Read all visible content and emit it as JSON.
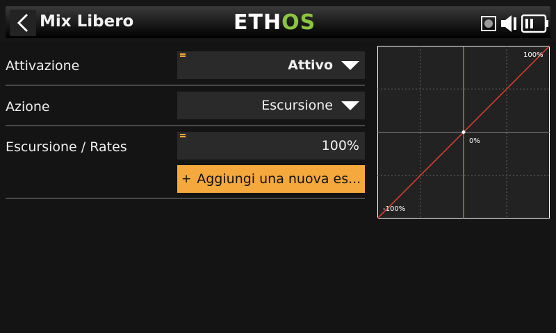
{
  "header": {
    "title": "Mix Libero",
    "logo_part1": "ETH",
    "logo_part2": "OS",
    "back_icon": "chevron-left-icon",
    "status_icons": [
      "record-icon",
      "speaker-icon",
      "battery-icon"
    ]
  },
  "rows": {
    "activation": {
      "label": "Attivazione",
      "value": "Attivo"
    },
    "action": {
      "label": "Azione",
      "value": "Escursione"
    },
    "rates": {
      "label": "Escursione / Rates",
      "value": "100%"
    }
  },
  "add_button": {
    "icon": "+",
    "label": "Aggiungi una nuova es..."
  },
  "colors": {
    "accent": "#f5a83b",
    "logo_green": "#8bc53f",
    "curve": "#e0402d",
    "center_line": "#f3a739"
  },
  "chart_data": {
    "type": "line",
    "x": [
      -100,
      100
    ],
    "y": [
      -100,
      100
    ],
    "xlim": [
      -100,
      100
    ],
    "ylim": [
      -100,
      100
    ],
    "grid": true,
    "labels": {
      "top_right": "100%",
      "center": "0%",
      "bottom_left": "-100%"
    },
    "point": [
      0,
      0
    ]
  }
}
